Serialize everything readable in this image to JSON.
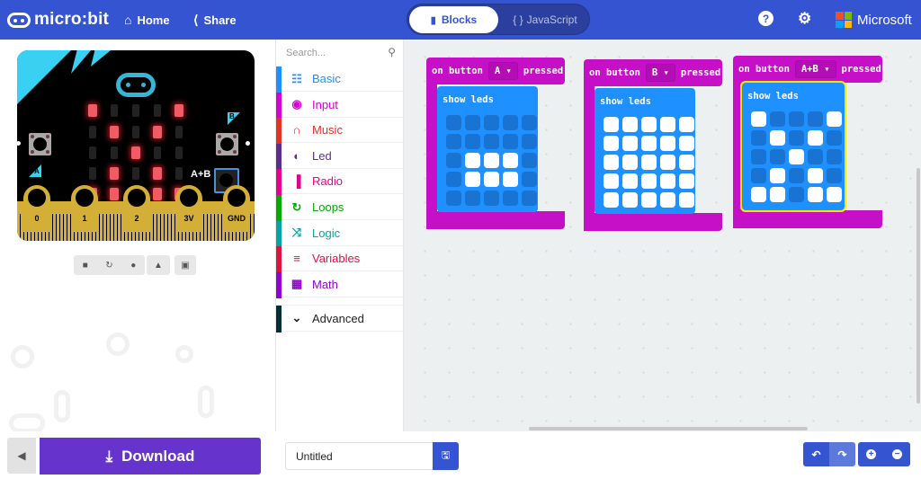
{
  "header": {
    "logo_text": "micro:bit",
    "home_label": "Home",
    "share_label": "Share",
    "blocks_label": "Blocks",
    "javascript_label": "JavaScript",
    "javascript_icon": "{ }",
    "help_icon": "?",
    "settings_icon": "⚙",
    "brand_label": "Microsoft",
    "brand_colors": [
      "#F25022",
      "#7FBA00",
      "#00A4EF",
      "#FFB900"
    ],
    "accent_color": "#3454D1"
  },
  "simulator": {
    "led_pattern": [
      [
        1,
        0,
        0,
        0,
        1
      ],
      [
        0,
        1,
        0,
        1,
        0
      ],
      [
        0,
        0,
        1,
        0,
        0
      ],
      [
        0,
        1,
        0,
        1,
        0
      ],
      [
        1,
        1,
        0,
        1,
        1
      ]
    ],
    "button_a_label": "A",
    "button_b_label": "B",
    "button_ab_label": "A+B",
    "pins": [
      "0",
      "1",
      "2",
      "3V",
      "GND"
    ],
    "controls": [
      "stop",
      "restart",
      "slow-motion",
      "mute",
      "fullscreen"
    ]
  },
  "toolbox": {
    "search_placeholder": "Search...",
    "categories": [
      {
        "label": "Basic",
        "icon": "grid",
        "color": "#1E90FF"
      },
      {
        "label": "Input",
        "icon": "target",
        "color": "#D400D4"
      },
      {
        "label": "Music",
        "icon": "headphones",
        "color": "#E63022"
      },
      {
        "label": "Led",
        "icon": "toggle",
        "color": "#5C2D91"
      },
      {
        "label": "Radio",
        "icon": "signal",
        "color": "#E3008C"
      },
      {
        "label": "Loops",
        "icon": "refresh",
        "color": "#00AA00"
      },
      {
        "label": "Logic",
        "icon": "shuffle",
        "color": "#00A4A6"
      },
      {
        "label": "Variables",
        "icon": "list",
        "color": "#DC143C"
      },
      {
        "label": "Math",
        "icon": "calculator",
        "color": "#9400D3"
      }
    ],
    "advanced": {
      "label": "Advanced",
      "color": "#042E33"
    }
  },
  "workspace": {
    "blocks": [
      {
        "prefix": "on button",
        "button": "A",
        "suffix": "pressed",
        "inner_label": "show leds",
        "selected": false,
        "leds": [
          [
            0,
            0,
            0,
            0,
            0
          ],
          [
            0,
            0,
            0,
            0,
            0
          ],
          [
            0,
            1,
            1,
            1,
            0
          ],
          [
            0,
            1,
            1,
            1,
            0
          ],
          [
            0,
            0,
            0,
            0,
            0
          ]
        ]
      },
      {
        "prefix": "on button",
        "button": "B",
        "suffix": "pressed",
        "inner_label": "show leds",
        "selected": false,
        "leds": [
          [
            1,
            1,
            1,
            1,
            1
          ],
          [
            1,
            1,
            1,
            1,
            1
          ],
          [
            1,
            1,
            1,
            1,
            1
          ],
          [
            1,
            1,
            1,
            1,
            1
          ],
          [
            1,
            1,
            1,
            1,
            1
          ]
        ]
      },
      {
        "prefix": "on button",
        "button": "A+B",
        "suffix": "pressed",
        "inner_label": "show leds",
        "selected": true,
        "leds": [
          [
            1,
            0,
            0,
            0,
            1
          ],
          [
            0,
            1,
            0,
            1,
            0
          ],
          [
            0,
            0,
            1,
            0,
            0
          ],
          [
            0,
            1,
            0,
            1,
            0
          ],
          [
            1,
            1,
            0,
            1,
            1
          ]
        ]
      }
    ]
  },
  "footer": {
    "download_label": "Download",
    "project_name": "Untitled",
    "undo_icon": "↶",
    "redo_icon": "↷",
    "zoom_in_icon": "+",
    "zoom_out_icon": "−"
  }
}
